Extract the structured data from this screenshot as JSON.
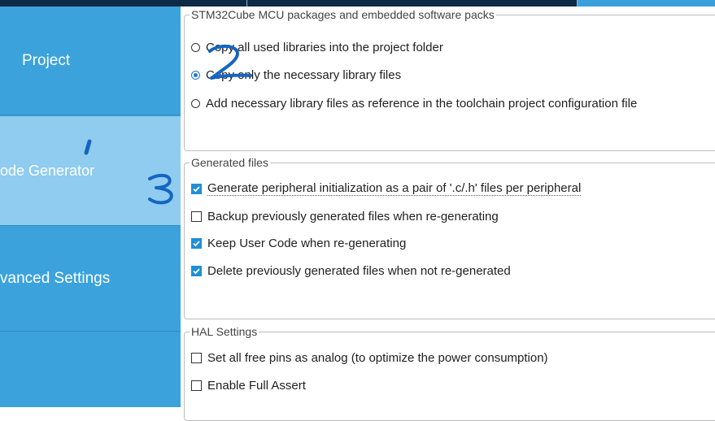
{
  "sidebar": {
    "items": [
      {
        "label": "Project"
      },
      {
        "label": "ode Generator"
      },
      {
        "label": "vanced Settings"
      },
      {
        "label": ""
      }
    ]
  },
  "groups": {
    "packages": {
      "legend": "STM32Cube MCU packages and embedded software packs",
      "options": [
        {
          "label": "Copy all used libraries into the project folder",
          "selected": false
        },
        {
          "label": "Copy only the necessary library files",
          "selected": true
        },
        {
          "label": "Add necessary library files as reference in the toolchain project configuration file",
          "selected": false
        }
      ]
    },
    "generated": {
      "legend": "Generated files",
      "options": [
        {
          "label": "Generate peripheral initialization as a pair of '.c/.h' files per peripheral",
          "checked": true
        },
        {
          "label": "Backup previously generated files when re-generating",
          "checked": false
        },
        {
          "label": "Keep User Code when re-generating",
          "checked": true
        },
        {
          "label": "Delete previously generated files when not re-generated",
          "checked": true
        }
      ]
    },
    "hal": {
      "legend": "HAL Settings",
      "options": [
        {
          "label": "Set all free pins as analog (to optimize the power consumption)",
          "checked": false
        },
        {
          "label": "Enable Full Assert",
          "checked": false
        }
      ]
    }
  },
  "colors": {
    "sidebar_bg": "#3ba2dc",
    "sidebar_active": "#8fccef",
    "accent": "#1f8fd8",
    "ink": "#1565c0"
  }
}
